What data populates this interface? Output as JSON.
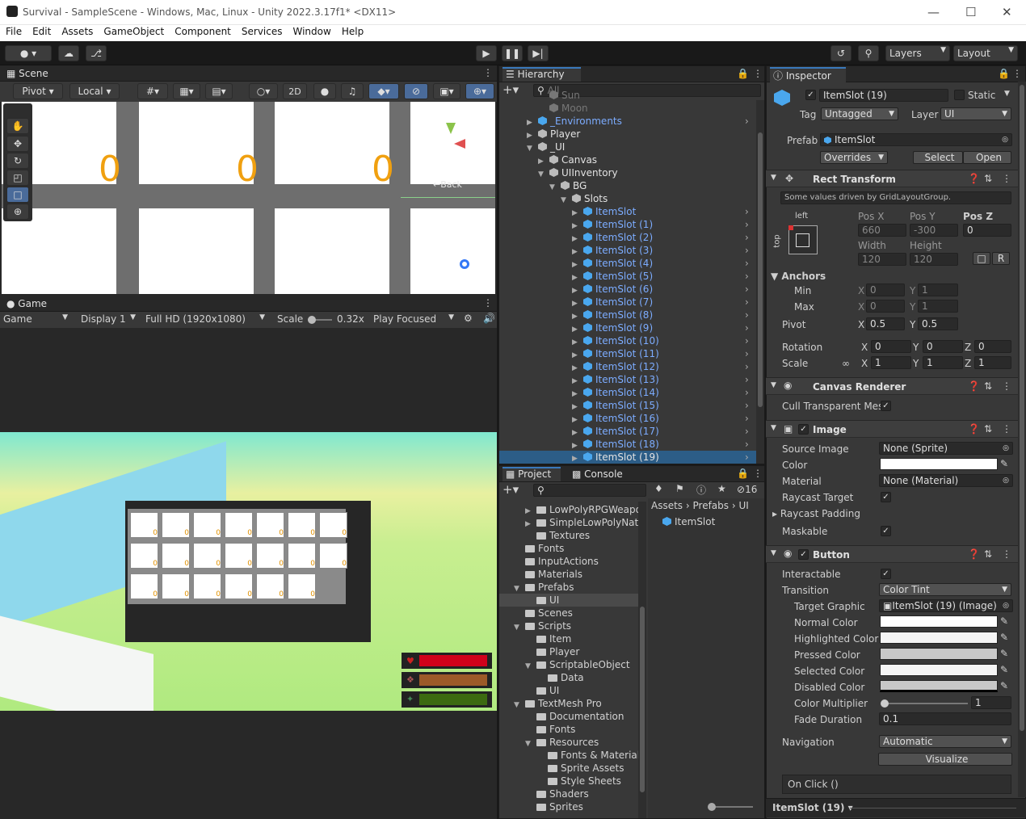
{
  "window": {
    "title": "Survival - SampleScene - Windows, Mac, Linux - Unity 2022.3.17f1* <DX11>"
  },
  "menu": [
    "File",
    "Edit",
    "Assets",
    "GameObject",
    "Component",
    "Services",
    "Window",
    "Help"
  ],
  "toolbar": {
    "layers": "Layers",
    "layout": "Layout"
  },
  "scene": {
    "tab": "Scene",
    "pivot": "Pivot",
    "local": "Local",
    "mode2d": "2D",
    "digit": "0",
    "back_label": "←Back"
  },
  "game": {
    "tab": "Game",
    "display_mode": "Game",
    "display": "Display 1",
    "resolution": "Full HD (1920x1080)",
    "scale_label": "Scale",
    "scale_value": "0.32x",
    "play_mode": "Play Focused",
    "slot_digit": "0"
  },
  "hierarchy": {
    "tab": "Hierarchy",
    "search_placeholder": "All",
    "rows": [
      {
        "label": "Sun",
        "indent": 2,
        "icon": "dim",
        "color": "dim"
      },
      {
        "label": "Moon",
        "indent": 2,
        "icon": "dim",
        "color": "dim"
      },
      {
        "label": "_Environments",
        "indent": 1,
        "icon": "blue",
        "color": "blue",
        "arrow": "▶"
      },
      {
        "label": "Player",
        "indent": 1,
        "icon": "gray",
        "color": "white",
        "arrow": "▶"
      },
      {
        "label": "_UI",
        "indent": 1,
        "icon": "gray",
        "color": "white",
        "arrow": "▼"
      },
      {
        "label": "Canvas",
        "indent": 2,
        "icon": "gray",
        "color": "white",
        "arrow": "▶"
      },
      {
        "label": "UIInventory",
        "indent": 2,
        "icon": "gray",
        "color": "white",
        "arrow": "▼"
      },
      {
        "label": "BG",
        "indent": 3,
        "icon": "gray",
        "color": "white",
        "arrow": "▼"
      },
      {
        "label": "Slots",
        "indent": 4,
        "icon": "gray",
        "color": "white",
        "arrow": "▼"
      },
      {
        "label": "ItemSlot",
        "indent": 5,
        "icon": "blue",
        "color": "blue",
        "arrow": "▶"
      },
      {
        "label": "ItemSlot (1)",
        "indent": 5,
        "icon": "blue",
        "color": "blue",
        "arrow": "▶"
      },
      {
        "label": "ItemSlot (2)",
        "indent": 5,
        "icon": "blue",
        "color": "blue",
        "arrow": "▶"
      },
      {
        "label": "ItemSlot (3)",
        "indent": 5,
        "icon": "blue",
        "color": "blue",
        "arrow": "▶"
      },
      {
        "label": "ItemSlot (4)",
        "indent": 5,
        "icon": "blue",
        "color": "blue",
        "arrow": "▶"
      },
      {
        "label": "ItemSlot (5)",
        "indent": 5,
        "icon": "blue",
        "color": "blue",
        "arrow": "▶"
      },
      {
        "label": "ItemSlot (6)",
        "indent": 5,
        "icon": "blue",
        "color": "blue",
        "arrow": "▶"
      },
      {
        "label": "ItemSlot (7)",
        "indent": 5,
        "icon": "blue",
        "color": "blue",
        "arrow": "▶"
      },
      {
        "label": "ItemSlot (8)",
        "indent": 5,
        "icon": "blue",
        "color": "blue",
        "arrow": "▶"
      },
      {
        "label": "ItemSlot (9)",
        "indent": 5,
        "icon": "blue",
        "color": "blue",
        "arrow": "▶"
      },
      {
        "label": "ItemSlot (10)",
        "indent": 5,
        "icon": "blue",
        "color": "blue",
        "arrow": "▶"
      },
      {
        "label": "ItemSlot (11)",
        "indent": 5,
        "icon": "blue",
        "color": "blue",
        "arrow": "▶"
      },
      {
        "label": "ItemSlot (12)",
        "indent": 5,
        "icon": "blue",
        "color": "blue",
        "arrow": "▶"
      },
      {
        "label": "ItemSlot (13)",
        "indent": 5,
        "icon": "blue",
        "color": "blue",
        "arrow": "▶"
      },
      {
        "label": "ItemSlot (14)",
        "indent": 5,
        "icon": "blue",
        "color": "blue",
        "arrow": "▶"
      },
      {
        "label": "ItemSlot (15)",
        "indent": 5,
        "icon": "blue",
        "color": "blue",
        "arrow": "▶"
      },
      {
        "label": "ItemSlot (16)",
        "indent": 5,
        "icon": "blue",
        "color": "blue",
        "arrow": "▶"
      },
      {
        "label": "ItemSlot (17)",
        "indent": 5,
        "icon": "blue",
        "color": "blue",
        "arrow": "▶"
      },
      {
        "label": "ItemSlot (18)",
        "indent": 5,
        "icon": "blue",
        "color": "blue",
        "arrow": "▶"
      },
      {
        "label": "ItemSlot (19)",
        "indent": 5,
        "icon": "blue",
        "color": "white",
        "arrow": "▶",
        "selected": true
      }
    ]
  },
  "project": {
    "tab_project": "Project",
    "tab_console": "Console",
    "hidden_count": "16",
    "breadcrumb": [
      "Assets",
      "Prefabs",
      "UI"
    ],
    "asset": "ItemSlot",
    "tree": [
      {
        "label": "LowPolyRPGWeapo",
        "indent": 2,
        "arrow": "▶"
      },
      {
        "label": "SimpleLowPolyNatu",
        "indent": 2,
        "arrow": "▶"
      },
      {
        "label": "Textures",
        "indent": 2,
        "arrow": ""
      },
      {
        "label": "Fonts",
        "indent": 1,
        "arrow": ""
      },
      {
        "label": "InputActions",
        "indent": 1,
        "arrow": ""
      },
      {
        "label": "Materials",
        "indent": 1,
        "arrow": ""
      },
      {
        "label": "Prefabs",
        "indent": 1,
        "arrow": "▼"
      },
      {
        "label": "UI",
        "indent": 2,
        "arrow": "",
        "selected": true
      },
      {
        "label": "Scenes",
        "indent": 1,
        "arrow": ""
      },
      {
        "label": "Scripts",
        "indent": 1,
        "arrow": "▼"
      },
      {
        "label": "Item",
        "indent": 2,
        "arrow": ""
      },
      {
        "label": "Player",
        "indent": 2,
        "arrow": ""
      },
      {
        "label": "ScriptableObject",
        "indent": 2,
        "arrow": "▼"
      },
      {
        "label": "Data",
        "indent": 3,
        "arrow": ""
      },
      {
        "label": "UI",
        "indent": 2,
        "arrow": ""
      },
      {
        "label": "TextMesh Pro",
        "indent": 1,
        "arrow": "▼"
      },
      {
        "label": "Documentation",
        "indent": 2,
        "arrow": ""
      },
      {
        "label": "Fonts",
        "indent": 2,
        "arrow": ""
      },
      {
        "label": "Resources",
        "indent": 2,
        "arrow": "▼"
      },
      {
        "label": "Fonts & Materials",
        "indent": 3,
        "arrow": ""
      },
      {
        "label": "Sprite Assets",
        "indent": 3,
        "arrow": ""
      },
      {
        "label": "Style Sheets",
        "indent": 3,
        "arrow": ""
      },
      {
        "label": "Shaders",
        "indent": 2,
        "arrow": ""
      },
      {
        "label": "Sprites",
        "indent": 2,
        "arrow": ""
      }
    ]
  },
  "inspector": {
    "tab": "Inspector",
    "name": "ItemSlot (19)",
    "static": "Static",
    "tag_label": "Tag",
    "tag": "Untagged",
    "layer_label": "Layer",
    "layer": "UI",
    "prefab_label": "Prefab",
    "prefab": "ItemSlot",
    "overrides": "Overrides",
    "select": "Select",
    "open": "Open",
    "rect": {
      "title": "Rect Transform",
      "note": "Some values driven by GridLayoutGroup.",
      "left": "left",
      "top": "top",
      "posx_l": "Pos X",
      "posy_l": "Pos Y",
      "posz_l": "Pos Z",
      "posx": "660",
      "posy": "-300",
      "posz": "0",
      "width_l": "Width",
      "height_l": "Height",
      "width": "120",
      "height": "120",
      "r": "R",
      "anchors": "Anchors",
      "min": "Min",
      "max": "Max",
      "pivot": "Pivot",
      "rotation": "Rotation",
      "scale": "Scale",
      "x": "X",
      "y": "Y",
      "z": "Z",
      "min_x": "0",
      "min_y": "1",
      "max_x": "0",
      "max_y": "1",
      "pivot_x": "0.5",
      "pivot_y": "0.5",
      "rot_x": "0",
      "rot_y": "0",
      "rot_z": "0",
      "sc_x": "1",
      "sc_y": "1",
      "sc_z": "1"
    },
    "canvas_renderer": {
      "title": "Canvas Renderer",
      "cull": "Cull Transparent Mes"
    },
    "image": {
      "title": "Image",
      "source_l": "Source Image",
      "source": "None (Sprite)",
      "color_l": "Color",
      "material_l": "Material",
      "material": "None (Material)",
      "raycast_l": "Raycast Target",
      "padding_l": "Raycast Padding",
      "maskable_l": "Maskable"
    },
    "button": {
      "title": "Button",
      "interactable_l": "Interactable",
      "transition_l": "Transition",
      "transition": "Color Tint",
      "target_l": "Target Graphic",
      "target": "ItemSlot (19) (Image)",
      "normal_l": "Normal Color",
      "highlighted_l": "Highlighted Color",
      "pressed_l": "Pressed Color",
      "selected_l": "Selected Color",
      "disabled_l": "Disabled Color",
      "multiplier_l": "Color Multiplier",
      "multiplier": "1",
      "fade_l": "Fade Duration",
      "fade": "0.1",
      "navigation_l": "Navigation",
      "navigation": "Automatic",
      "visualize": "Visualize",
      "onclick": "On Click ()"
    },
    "footer": "ItemSlot (19)"
  }
}
